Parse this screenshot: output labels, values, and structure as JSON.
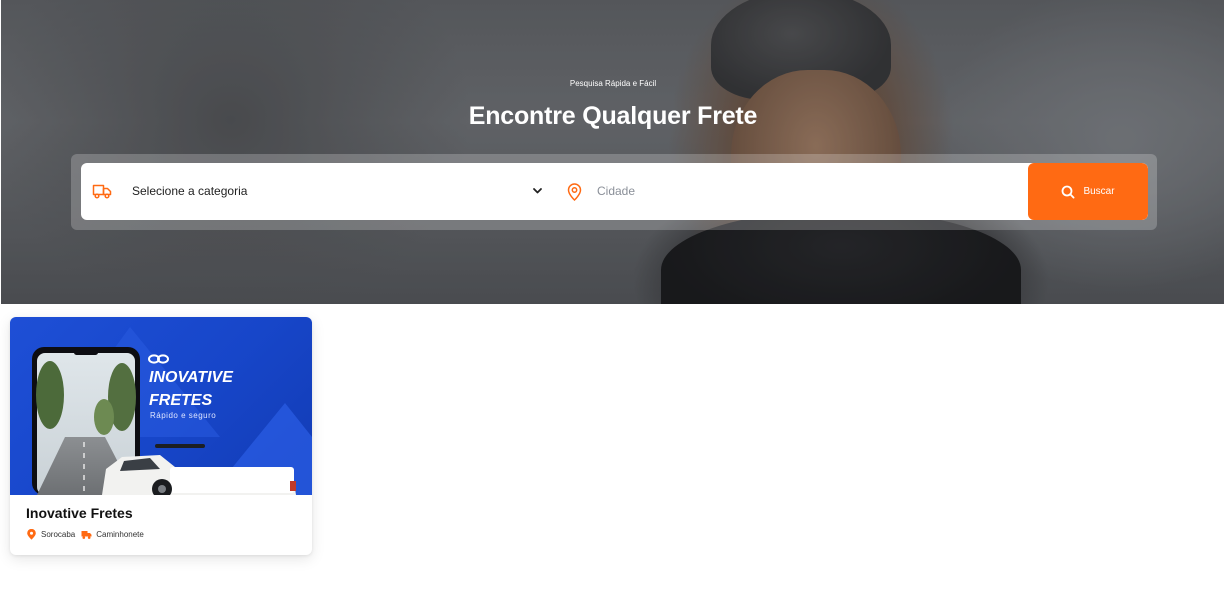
{
  "hero": {
    "tagline": "Pesquisa Rápida e Fácil",
    "title": "Encontre Qualquer Frete"
  },
  "search": {
    "category_selected": "Selecione a categoria",
    "city_placeholder": "Cidade",
    "button_label": "Buscar",
    "icons": [
      "truck-icon",
      "chevron-down-icon",
      "map-pin-icon",
      "search-icon"
    ]
  },
  "listings": [
    {
      "title": "Inovative Fretes",
      "image": {
        "brand_line_1": "INOVATIVE",
        "brand_line_2": "FRETES",
        "slogan": "Rápido e seguro"
      },
      "city": "Sorocaba",
      "vehicle": "Caminhonete"
    }
  ],
  "colors": {
    "accent": "#ff6a13",
    "card_banner_blue": "#1e4fd6"
  }
}
